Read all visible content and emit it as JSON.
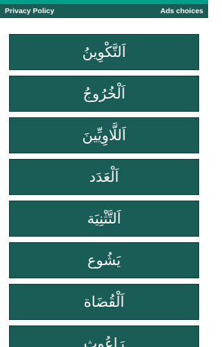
{
  "theme": {
    "accent_color": "#009f8c",
    "topbar_color": "#1a5c56",
    "tile_color": "#1a5c56"
  },
  "header": {
    "privacy_label": "Privacy Policy",
    "ads_label": "Ads choices"
  },
  "chapters": [
    {
      "title": "اَلتَّكْوِينُ"
    },
    {
      "title": "اَلْخُرُوجُ"
    },
    {
      "title": "اَللَّاوِيِّينَ"
    },
    {
      "title": "اَلْعَدَد"
    },
    {
      "title": "اَلتَّثْنِيَة"
    },
    {
      "title": "يَشُوع"
    },
    {
      "title": "اَلْقُضَاة"
    },
    {
      "title": "رَاعُوث"
    }
  ]
}
